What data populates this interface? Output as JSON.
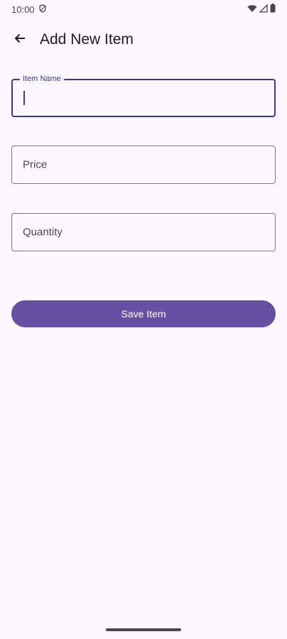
{
  "status_bar": {
    "time": "10:00",
    "icons": [
      "shield-icon",
      "wifi-icon",
      "signal-icon",
      "battery-icon"
    ]
  },
  "app_bar": {
    "back_icon": "arrow-back-icon",
    "title": "Add New Item"
  },
  "form": {
    "item_name": {
      "label": "Item Name",
      "value": ""
    },
    "price": {
      "label": "Price",
      "value": ""
    },
    "quantity": {
      "label": "Quantity",
      "value": ""
    }
  },
  "save_button": {
    "label": "Save Item"
  },
  "colors": {
    "background": "#fdf7fe",
    "primary": "#6750a4",
    "focus": "#3a3a9a",
    "outline": "#79747e"
  }
}
